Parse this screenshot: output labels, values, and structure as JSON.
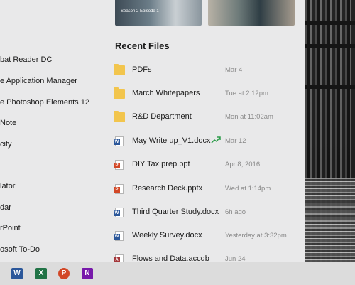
{
  "app_list": [
    {
      "label": "bat Reader DC"
    },
    {
      "label": "e Application Manager"
    },
    {
      "label": "e Photoshop Elements 12"
    },
    {
      "label": "Note"
    },
    {
      "label": "city"
    },
    {
      "label": "lator"
    },
    {
      "label": "dar"
    },
    {
      "label": "rPoint"
    },
    {
      "label": "osoft To-Do"
    }
  ],
  "thumbnails": [
    {
      "caption": "Season 2 Episode 1"
    },
    {
      "caption": ""
    }
  ],
  "recent": {
    "title": "Recent Files",
    "files": [
      {
        "name": "PDFs",
        "time": "Mar 4",
        "icon": "folder-icon"
      },
      {
        "name": "March Whitepapers",
        "time": "Tue at 2:12pm",
        "icon": "folder-icon"
      },
      {
        "name": "R&D Department",
        "time": "Mon at 11:02am",
        "icon": "folder-icon"
      },
      {
        "name": "May Write up_V1.docx",
        "time": "Mar 12",
        "icon": "word-doc-icon"
      },
      {
        "name": "DIY Tax prep.ppt",
        "time": "Apr 8, 2016",
        "icon": "powerpoint-doc-icon"
      },
      {
        "name": "Research Deck.pptx",
        "time": "Wed at 1:14pm",
        "icon": "powerpoint-doc-icon"
      },
      {
        "name": "Third Quarter Study.docx",
        "time": "6h ago",
        "icon": "word-doc-icon"
      },
      {
        "name": "Weekly Survey.docx",
        "time": "Yesterday at 3:32pm",
        "icon": "word-doc-icon"
      },
      {
        "name": "Flows and Data.accdb",
        "time": "Jun 24",
        "icon": "access-doc-icon"
      }
    ]
  },
  "taskbar": {
    "word_letter": "W",
    "excel_letter": "X",
    "ppt_letter": "P",
    "onenote_letter": "N"
  },
  "colors": {
    "folder": "#f2c54d",
    "word": "#2b579a",
    "excel": "#217346",
    "powerpoint": "#d24726",
    "onenote": "#7719aa",
    "trend": "#2e9c4a"
  }
}
